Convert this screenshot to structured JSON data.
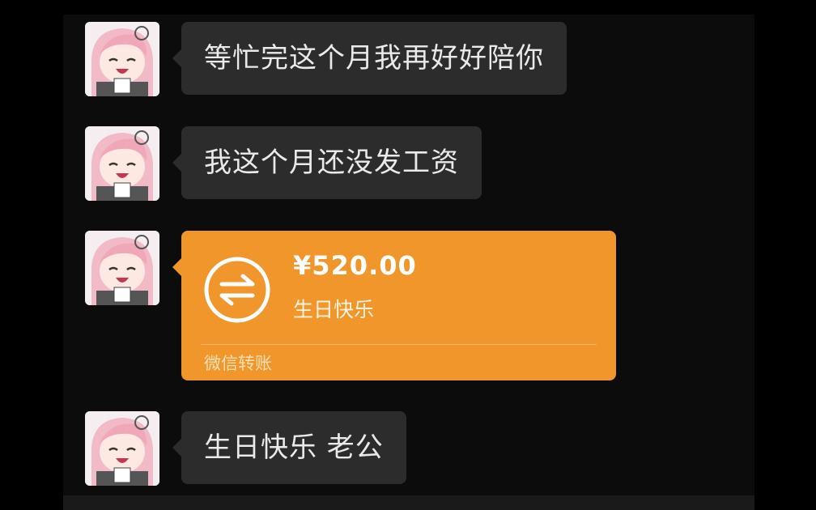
{
  "colors": {
    "background": "#000000",
    "chat_panel": "#0c0c0c",
    "bubble": "#2c2c2c",
    "bubble_text": "#eaeaea",
    "transfer_card": "#f0962b"
  },
  "messages": [
    {
      "type": "text",
      "text": "等忙完这个月我再好好陪你",
      "avatar": "anime-girl-avatar"
    },
    {
      "type": "text",
      "text": "我这个月还没发工资",
      "avatar": "anime-girl-avatar"
    },
    {
      "type": "transfer",
      "amount": "¥520.00",
      "note": "生日快乐",
      "source": "微信转账",
      "icon": "transfer-arrows-icon",
      "avatar": "anime-girl-avatar"
    },
    {
      "type": "text",
      "text": "生日快乐 老公",
      "avatar": "anime-girl-avatar"
    }
  ]
}
